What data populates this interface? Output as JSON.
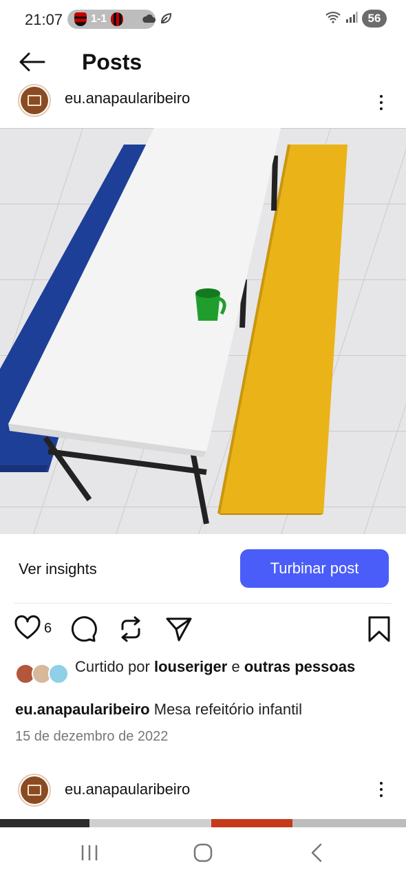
{
  "status_bar": {
    "time": "21:07",
    "score": "1-1",
    "battery": "56"
  },
  "header": {
    "title": "Posts"
  },
  "post": {
    "username": "eu.anapaularibeiro",
    "photo_description_icon": "photo",
    "insights_label": "Ver insights",
    "boost_label": "Turbinar post",
    "like_count": "6",
    "liked_by_prefix": "Curtido por",
    "liked_by_user": "louseriger",
    "liked_by_connector": "e",
    "liked_by_others": "outras pessoas",
    "caption_user": "eu.anapaularibeiro",
    "caption_text": "Mesa refeitório infantil",
    "date": "15 de dezembro de 2022"
  },
  "next_post": {
    "username": "eu.anapaularibeiro"
  },
  "colors": {
    "accent": "#4a5df9",
    "avatar_brown": "#8a4b22"
  },
  "icons": {
    "back": "arrow-left-icon",
    "more": "more-vertical-icon",
    "like": "heart-icon",
    "comment": "comment-icon",
    "repost": "repost-icon",
    "share": "send-icon",
    "save": "bookmark-icon",
    "nav_recent": "recents-icon",
    "nav_home": "home-icon",
    "nav_back": "back-chevron-icon"
  }
}
